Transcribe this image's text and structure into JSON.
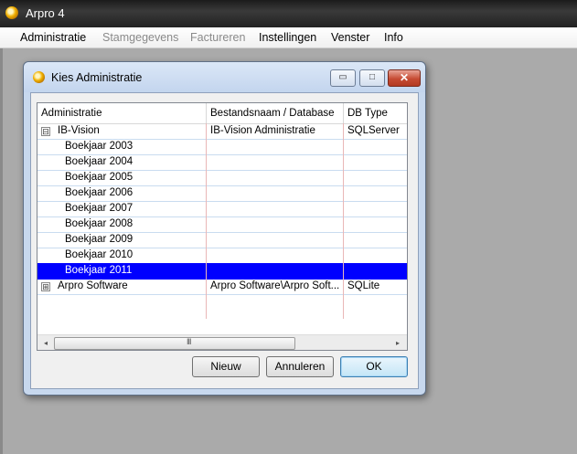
{
  "app": {
    "title": "Arpro 4"
  },
  "menu": [
    {
      "label": "Administratie",
      "enabled": true
    },
    {
      "label": "Stamgegevens",
      "enabled": false
    },
    {
      "label": "Factureren",
      "enabled": false
    },
    {
      "label": "Instellingen",
      "enabled": true
    },
    {
      "label": "Venster",
      "enabled": true
    },
    {
      "label": "Info",
      "enabled": true
    }
  ],
  "dialog": {
    "title": "Kies Administratie",
    "controls": {
      "minimize": "▭",
      "maximize": "□",
      "close": "✕"
    },
    "grid": {
      "columns": [
        "Administratie",
        "Bestandsnaam / Database",
        "DB Type"
      ],
      "rows": [
        {
          "expander": "⊟",
          "name": "IB-Vision",
          "file": "IB-Vision Administratie",
          "type": "SQLServer",
          "level": 0
        },
        {
          "name": "Boekjaar 2003",
          "file": "",
          "type": "",
          "level": 1
        },
        {
          "name": "Boekjaar 2004",
          "file": "",
          "type": "",
          "level": 1
        },
        {
          "name": "Boekjaar 2005",
          "file": "",
          "type": "",
          "level": 1
        },
        {
          "name": "Boekjaar 2006",
          "file": "",
          "type": "",
          "level": 1
        },
        {
          "name": "Boekjaar 2007",
          "file": "",
          "type": "",
          "level": 1
        },
        {
          "name": "Boekjaar 2008",
          "file": "",
          "type": "",
          "level": 1
        },
        {
          "name": "Boekjaar 2009",
          "file": "",
          "type": "",
          "level": 1
        },
        {
          "name": "Boekjaar 2010",
          "file": "",
          "type": "",
          "level": 1
        },
        {
          "name": "Boekjaar 2011",
          "file": "",
          "type": "",
          "level": 1,
          "selected": true
        },
        {
          "expander": "⊞",
          "name": "Arpro Software",
          "file": "Arpro Software\\Arpro Soft...",
          "type": "SQLite",
          "level": 0
        }
      ],
      "scroll": {
        "left": "◂",
        "right": "▸",
        "grip": "III"
      }
    },
    "buttons": {
      "new": "Nieuw",
      "cancel": "Annuleren",
      "ok": "OK"
    }
  },
  "colors": {
    "selection": "#0000ff",
    "dialog_frame": "#c7d8ee"
  }
}
